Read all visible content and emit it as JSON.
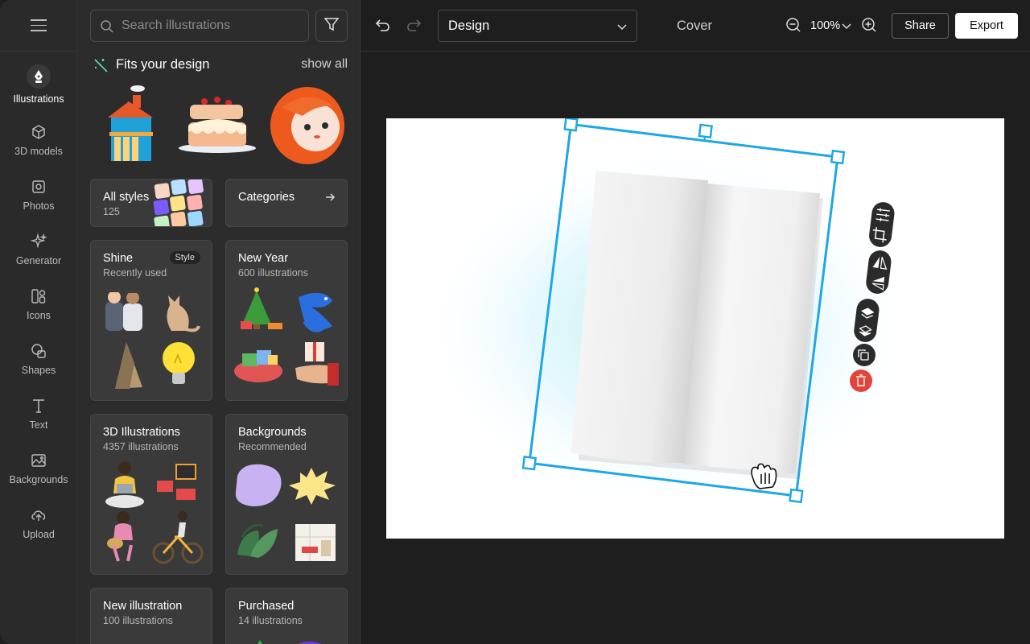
{
  "sidebar": {
    "items": [
      {
        "label": "Illustrations",
        "icon": "pen-nib-icon",
        "active": true
      },
      {
        "label": "3D models",
        "icon": "cube-icon"
      },
      {
        "label": "Photos",
        "icon": "photo-icon"
      },
      {
        "label": "Generator",
        "icon": "sparkles-icon"
      },
      {
        "label": "Icons",
        "icon": "icons-icon"
      },
      {
        "label": "Shapes",
        "icon": "shapes-icon"
      },
      {
        "label": "Text",
        "icon": "text-icon"
      },
      {
        "label": "Backgrounds",
        "icon": "image-icon"
      },
      {
        "label": "Upload",
        "icon": "cloud-upload-icon"
      }
    ]
  },
  "panel": {
    "search_placeholder": "Search illustrations",
    "fits_title": "Fits your design",
    "show_all": "show all",
    "cards": [
      {
        "title": "All styles",
        "subtitle": "125"
      },
      {
        "title": "Categories",
        "subtitle": ""
      },
      {
        "title": "Shine",
        "subtitle": "Recently used",
        "badge": "Style"
      },
      {
        "title": "New Year",
        "subtitle": "600 illustrations"
      },
      {
        "title": "3D Illustrations",
        "subtitle": "4357 illustrations"
      },
      {
        "title": "Backgrounds",
        "subtitle": "Recommended"
      },
      {
        "title": "New illustration",
        "subtitle": "100 illustrations"
      },
      {
        "title": "Purchased",
        "subtitle": "14 illustrations"
      }
    ]
  },
  "toolbar": {
    "page_select": "Design",
    "page_name": "Cover",
    "zoom": "100%",
    "share_label": "Share",
    "export_label": "Export"
  },
  "colors": {
    "accent": "#1ea7e4",
    "delete": "#e0443c",
    "canvas_bg": "#ffffff",
    "app_bg": "#1e1e1e"
  }
}
